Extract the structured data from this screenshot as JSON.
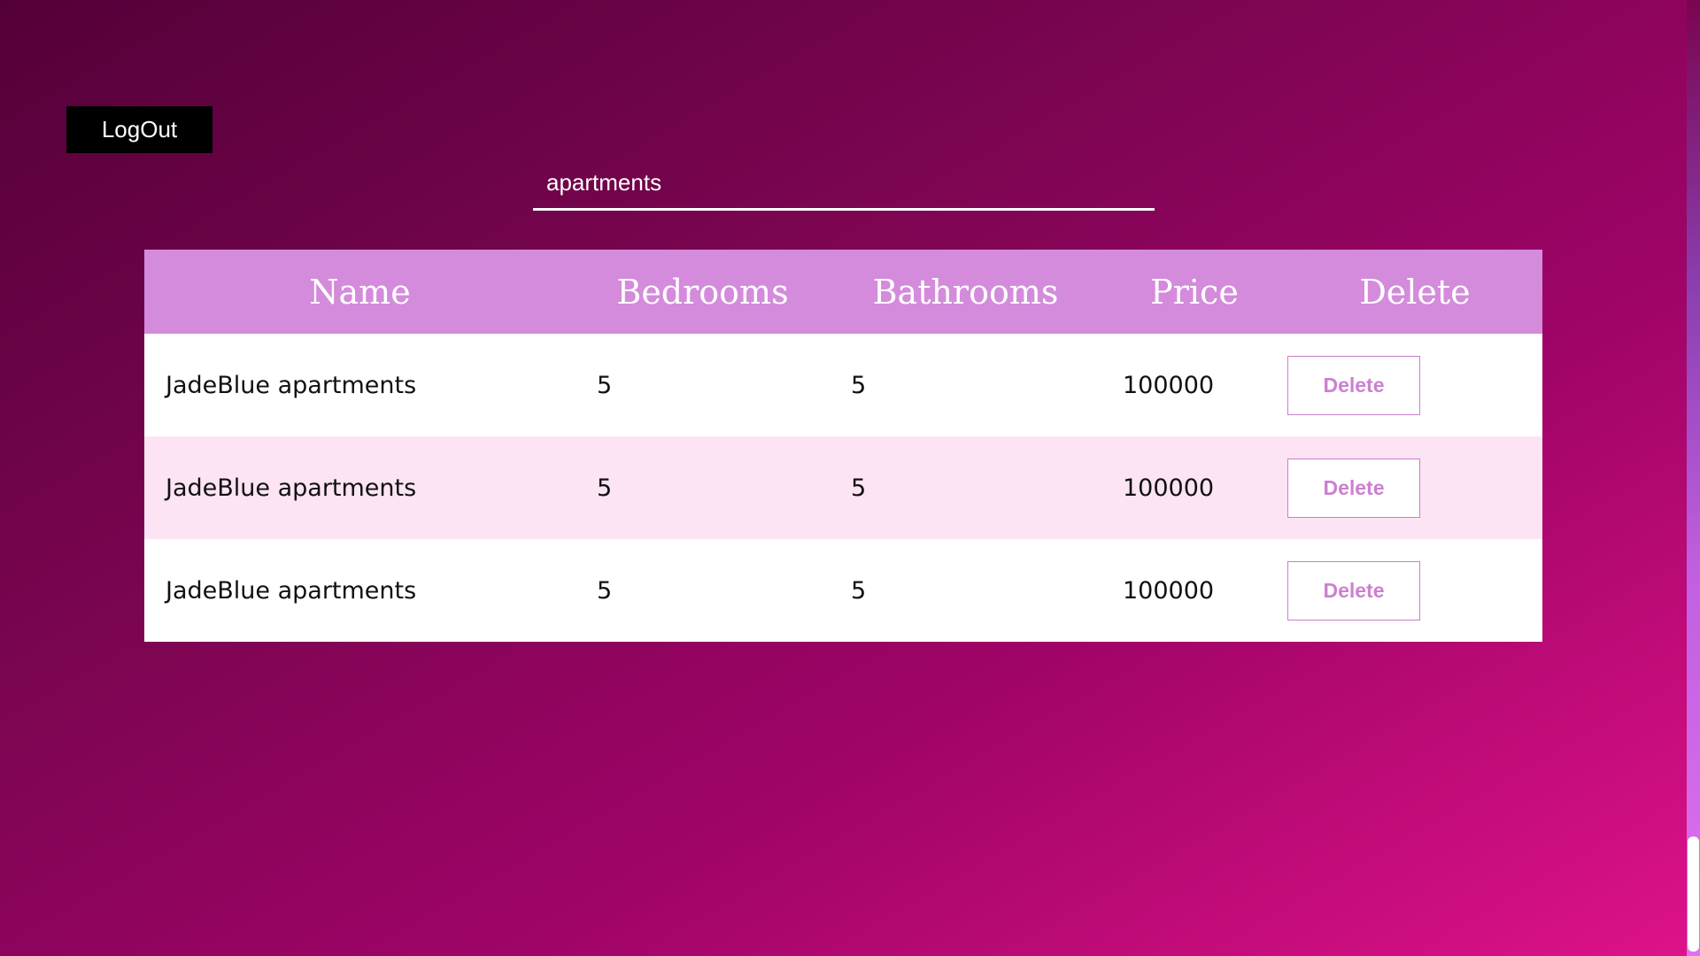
{
  "header": {
    "logout_label": "LogOut"
  },
  "search": {
    "value": "apartments"
  },
  "table": {
    "columns": [
      "Name",
      "Bedrooms",
      "Bathrooms",
      "Price",
      "Delete"
    ],
    "rows": [
      {
        "name": "JadeBlue apartments",
        "bedrooms": "5",
        "bathrooms": "5",
        "price": "100000",
        "delete_label": "Delete"
      },
      {
        "name": "JadeBlue apartments",
        "bedrooms": "5",
        "bathrooms": "5",
        "price": "100000",
        "delete_label": "Delete"
      },
      {
        "name": "JadeBlue apartments",
        "bedrooms": "5",
        "bathrooms": "5",
        "price": "100000",
        "delete_label": "Delete"
      }
    ]
  },
  "colors": {
    "header_bg": "#d48bdc",
    "row_alt_bg": "#fce4f5",
    "delete_text": "#cc80d0"
  }
}
